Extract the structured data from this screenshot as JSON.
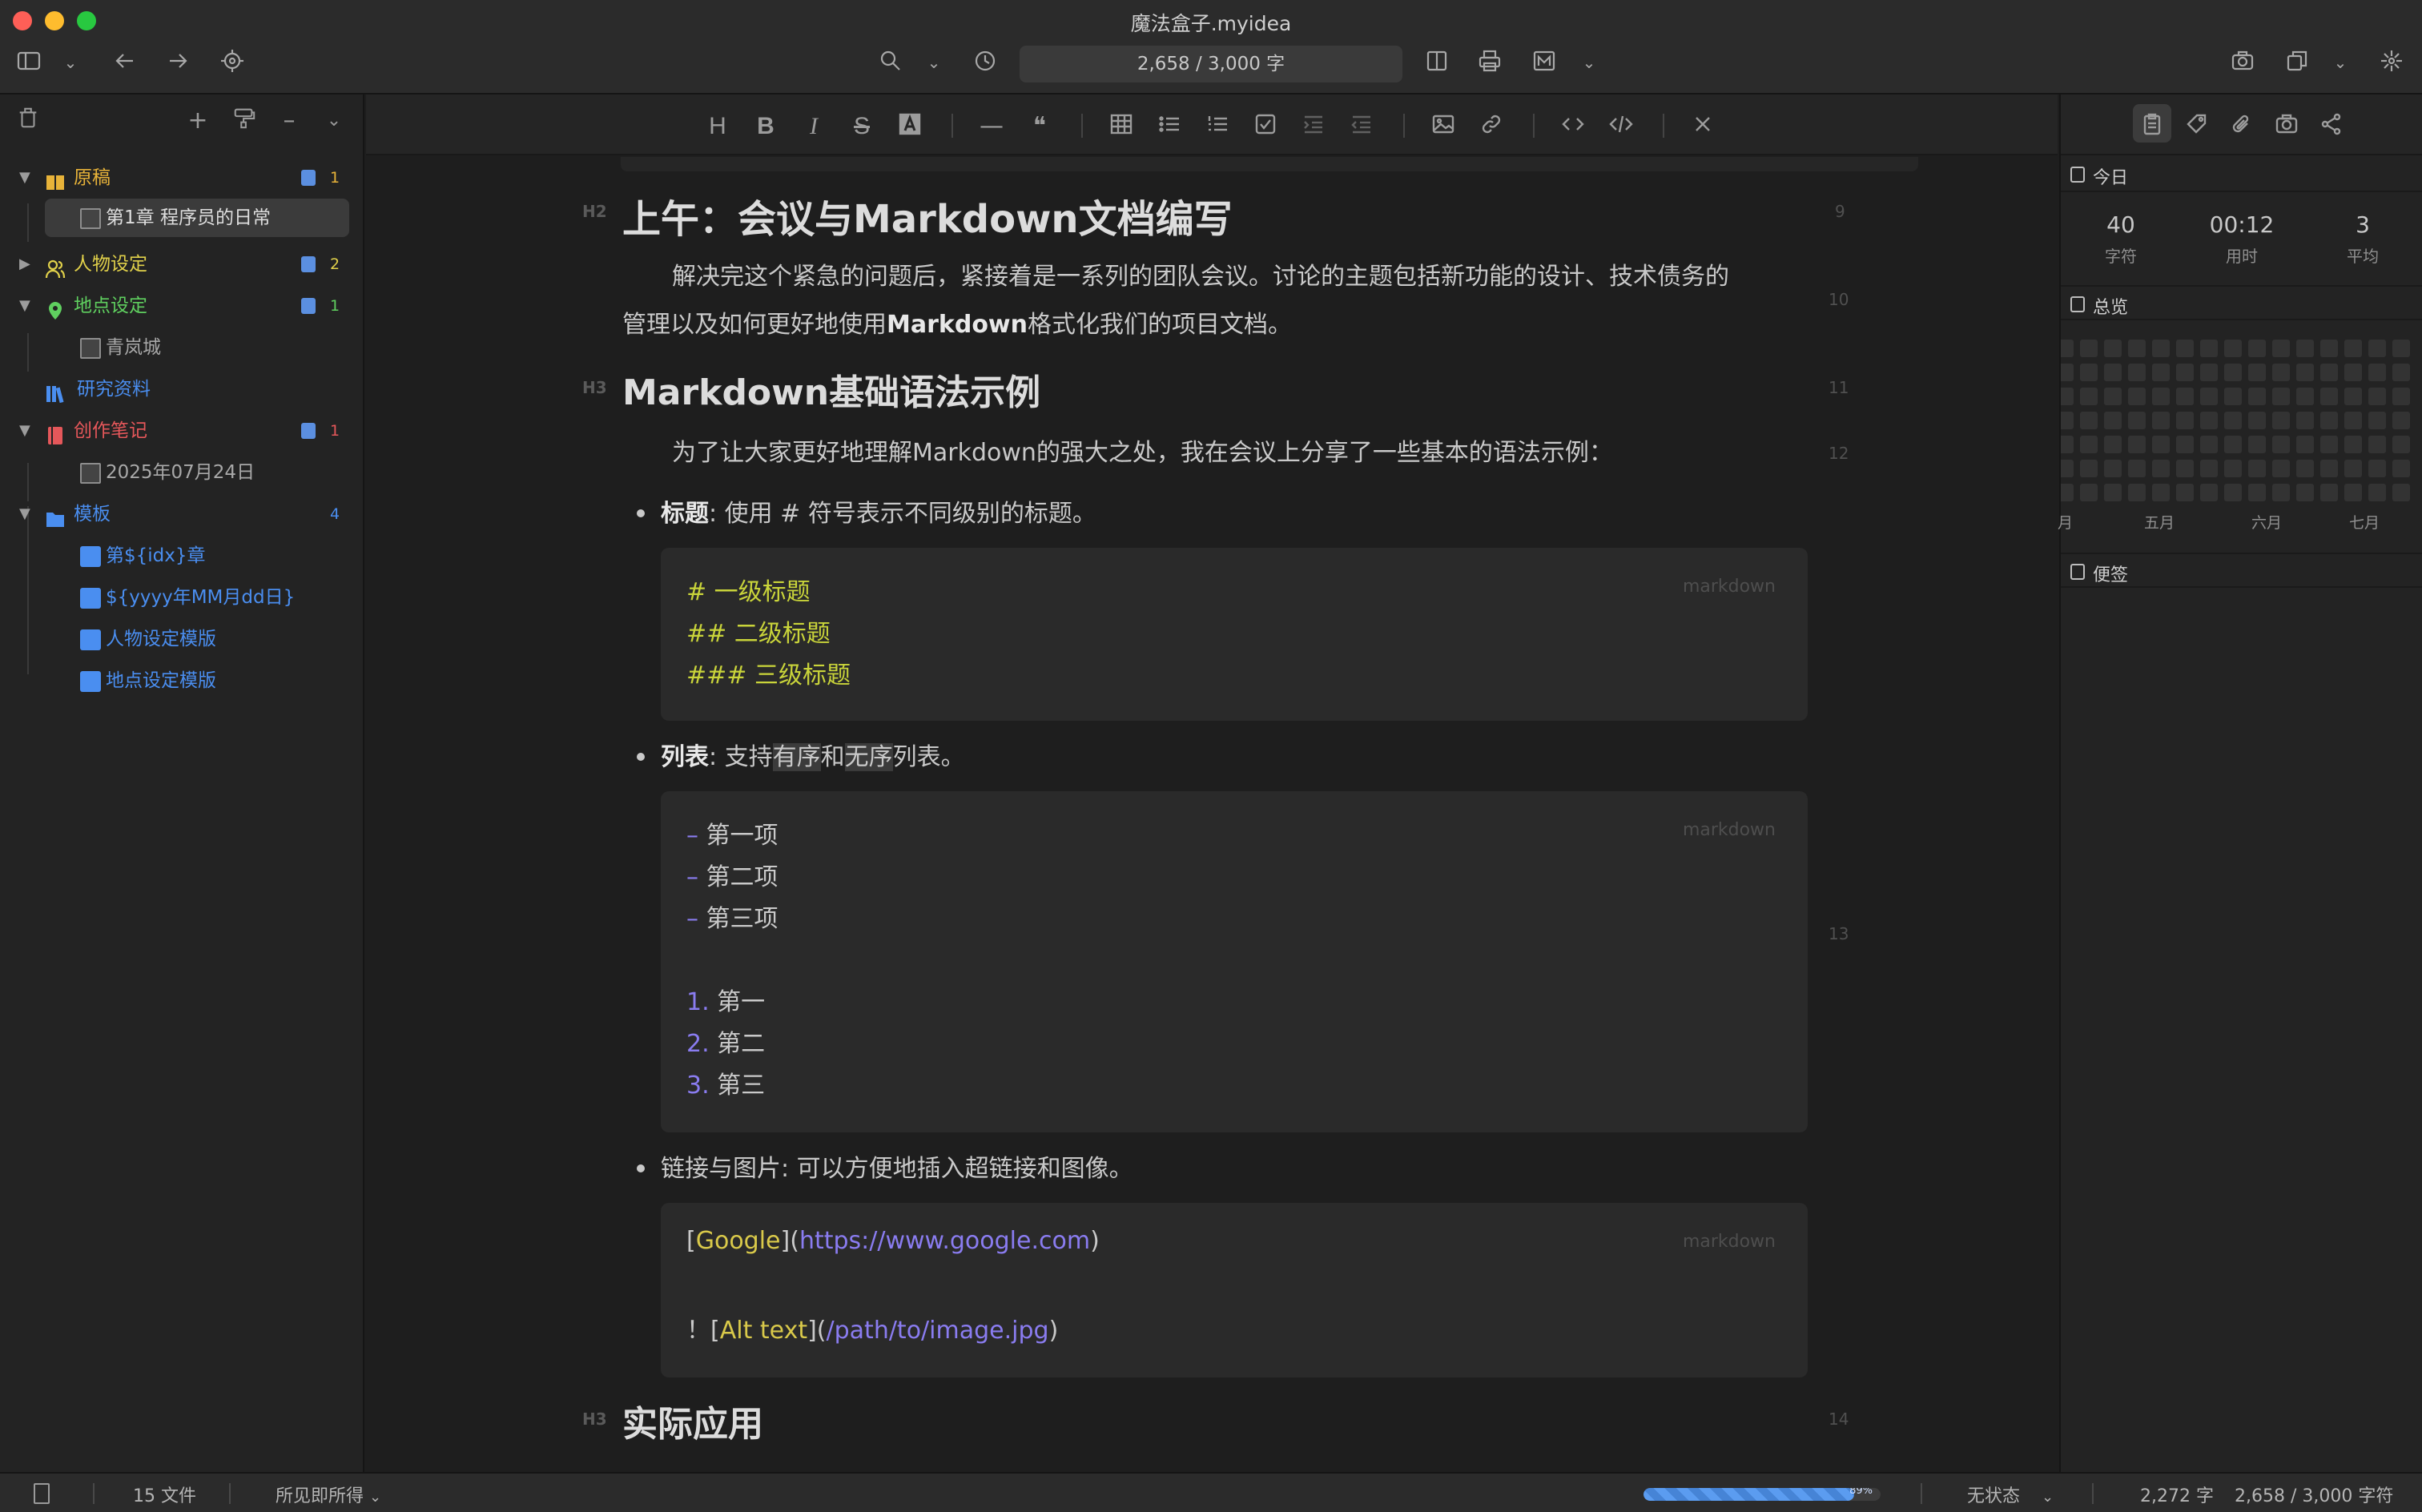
{
  "window": {
    "title": "魔法盒子.myidea",
    "word_count_box": "2,658 / 3,000 字"
  },
  "sidebar": {
    "tree": [
      {
        "label": "原稿",
        "count": "1",
        "color": "#e8b339",
        "icon": "book-icon"
      },
      {
        "label": "第1章 程序员的日常",
        "child": true
      },
      {
        "label": "人物设定",
        "count": "2",
        "color": "#e0d04a",
        "icon": "people-icon"
      },
      {
        "label": "地点设定",
        "count": "1",
        "color": "#5fcf5f",
        "icon": "location-pin-icon"
      },
      {
        "label": "青岚城",
        "child": true
      },
      {
        "label": "研究资料",
        "color": "#4a8ef0",
        "icon": "library-icon"
      },
      {
        "label": "创作笔记",
        "count": "1",
        "color": "#e5575a",
        "icon": "notebook-icon"
      },
      {
        "label": "2025年07月24日",
        "child": true
      },
      {
        "label": "模板",
        "count": "4",
        "color": "#4a8ef0",
        "icon": "folder-icon"
      },
      {
        "label": "第${idx}章",
        "template": true
      },
      {
        "label": "${yyyy年MM月dd日}",
        "template": true
      },
      {
        "label": "人物设定模版",
        "template": true
      },
      {
        "label": "地点设定模版",
        "template": true
      }
    ]
  },
  "editor": {
    "h2_title": "上午：会议与Markdown文档编写",
    "para1_line1": "解决完这个紧急的问题后，紧接着是一系列的团队会议。讨论的主题包括新功能的设计、技术债务的",
    "para1_line2_pre": "管理以及如何更好地使用",
    "para1_line2_bold": "Markdown",
    "para1_line2_post": "格式化我们的项目文档。",
    "h3_syntax": "Markdown基础语法示例",
    "para2": "为了让大家更好地理解Markdown的强大之处，我在会议上分享了一些基本的语法示例：",
    "bullet1_bold": "标题",
    "bullet1_text": ": 使用 # 符号表示不同级别的标题。",
    "code1": [
      "# 一级标题",
      "## 二级标题",
      "### 三级标题"
    ],
    "bullet2_bold": "列表",
    "bullet2_pre": ": 支持",
    "bullet2_hl1": "有序",
    "bullet2_mid": "和",
    "bullet2_hl2": "无序",
    "bullet2_post": "列表。",
    "code2_unordered_marker": "–",
    "code2_unordered": [
      "第一项",
      "第二项",
      "第三项"
    ],
    "code2_ordered_markers": [
      "1.",
      "2.",
      "3."
    ],
    "code2_ordered": [
      "第一",
      "第二",
      "第三"
    ],
    "bullet3_text": "链接与图片: 可以方便地插入超链接和图像。",
    "code3_link_text": "Google",
    "code3_link_url": "https://www.google.com",
    "code3_img_bang": "！",
    "code3_img_alt": "Alt text",
    "code3_img_path": "/path/to/image.jpg",
    "code_lang": "markdown",
    "h3_apply": "实际应用",
    "heading_markers": {
      "h2": "H2",
      "h3": "H3"
    },
    "line_numbers": [
      "9",
      "10",
      "11",
      "12",
      "13",
      "14"
    ]
  },
  "right_panel": {
    "today_label": "今日",
    "stats": [
      {
        "value": "40",
        "label": "字符"
      },
      {
        "value": "00:12",
        "label": "用时"
      },
      {
        "value": "3",
        "label": "平均"
      }
    ],
    "overview_label": "总览",
    "months": [
      "月",
      "五月",
      "六月",
      "七月"
    ],
    "notes_label": "便签"
  },
  "statusbar": {
    "file_count": "15 文件",
    "mode": "所见即所得",
    "progress": 0.89,
    "progress_text": "89%",
    "status": "无状态",
    "chars": "2,272 字",
    "goal": "2,658 / 3,000 字符"
  }
}
